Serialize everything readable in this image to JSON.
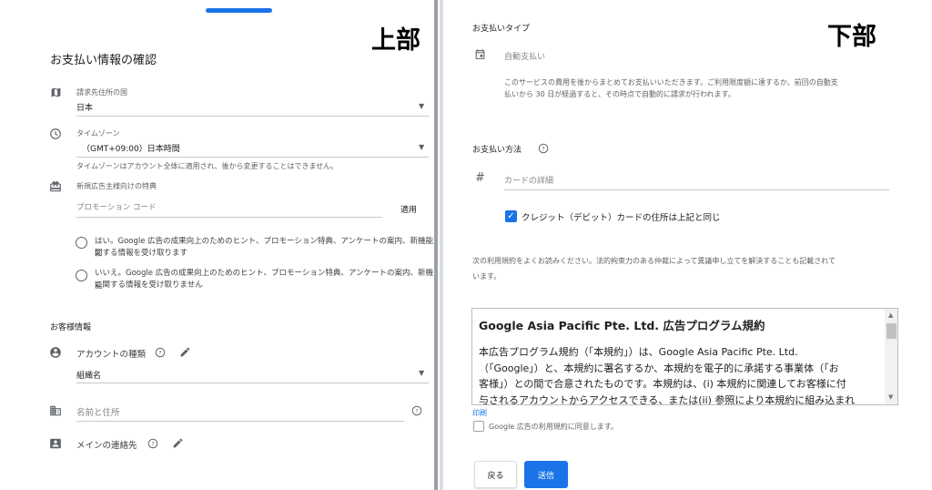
{
  "left": {
    "corner_label": "上部",
    "page_title": "お支払い情報の確認",
    "billing_country": {
      "label": "請求先住所の国",
      "value": "日本",
      "icon": "map-icon"
    },
    "timezone": {
      "label": "タイムゾーン",
      "value": "（GMT+09:00）日本時間",
      "help": "タイムゾーンはアカウント全体に適用され、後から変更することはできません。",
      "icon": "clock-icon"
    },
    "promo": {
      "label": "新規広告主様向けの特典",
      "placeholder": "プロモーション コード",
      "apply_label": "適用",
      "icon": "gift-icon"
    },
    "radio_yes": {
      "line1": "はい。Google 広告の成果向上のためのヒント、プロモーション特典、アンケートの案内、新機能に",
      "line2": "関する情報を受け取ります"
    },
    "radio_no": {
      "line1": "いいえ。Google 広告の成果向上のためのヒント、プロモーション特典、アンケートの案内、新機能",
      "line2": "に関する情報を受け取りません"
    },
    "customer_section": "お客様情報",
    "account_type": {
      "label": "アカウントの種類",
      "value": "組織名",
      "icon": "account-circle-icon"
    },
    "name_address": {
      "placeholder": "名前と住所",
      "icon": "building-icon"
    },
    "main_contact": {
      "label": "メインの連絡先",
      "icon": "contact-card-icon"
    }
  },
  "right": {
    "corner_label": "下部",
    "payment_type_title": "お支払いタイプ",
    "auto_payment": {
      "label": "自動支払い",
      "desc1": "このサービスの費用を後からまとめてお支払いいただきます。ご利用限度額に達するか、前回の自動支",
      "desc2": "払いから 30 日が経過すると、その時点で自動的に請求が行われます。",
      "icon": "calendar-icon"
    },
    "payment_method_title": "お支払い方法",
    "card_details_placeholder": "カードの詳細",
    "same_address_label": "クレジット（デビット）カードの住所は上記と同じ",
    "terms_notice1": "次の利用規約をよくお読みください。法的拘束力のある仲裁によって異議申し立てを解決することも記載されて",
    "terms_notice2": "います。",
    "terms": {
      "title": "Google Asia Pacific Pte. Ltd. 広告プログラム規約",
      "lines": [
        "本広告プログラム規約（「本規約」）は、Google Asia Pacific Pte. Ltd.",
        "（「Google」）と、本規約に署名するか、本規約を電子的に承諾する事業体（「お",
        "客様」）との間で合意されたものです。本規約は、(i) 本規約に関連してお客様に付",
        "与されるアカウントからアクセスできる、または(ii) 参照により本規約に組み込まれ"
      ]
    },
    "print_link": "印刷",
    "agree_label": "Google 広告の利用規約に同意します。",
    "back_button": "戻る",
    "submit_button": "送信"
  },
  "colors": {
    "accent": "#1a73e8",
    "divider": "#9aa0a6"
  }
}
